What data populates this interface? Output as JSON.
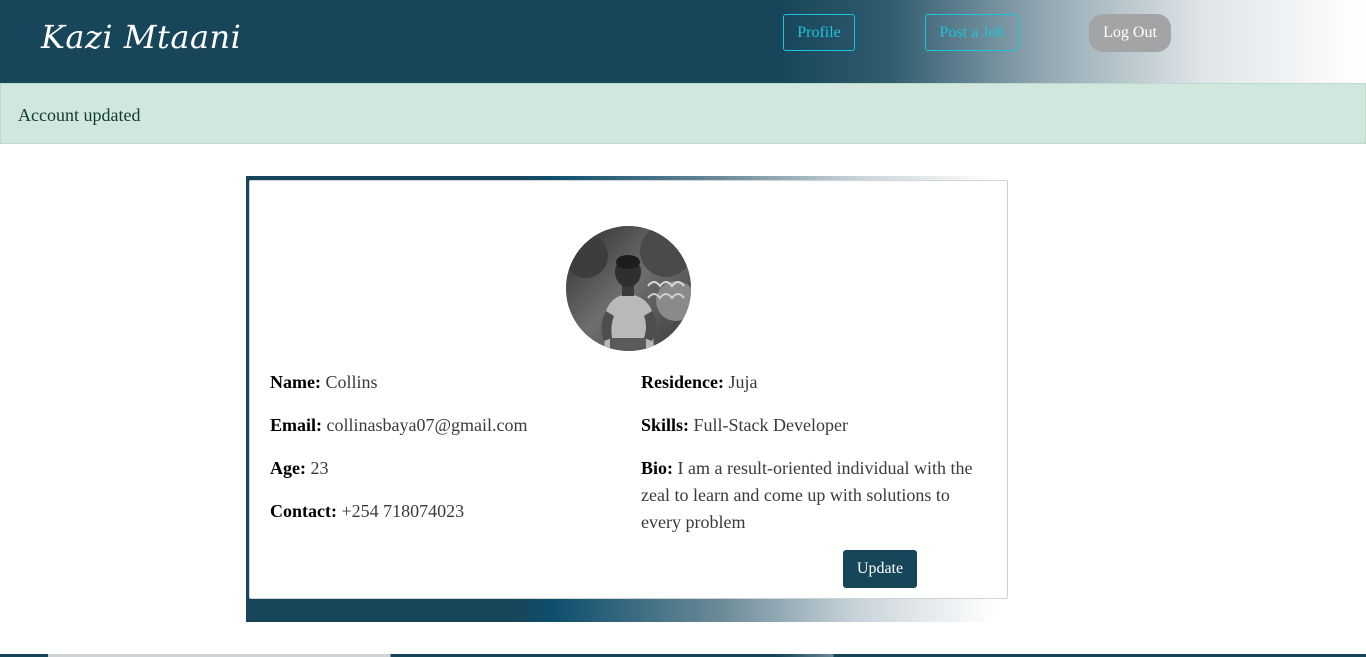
{
  "navbar": {
    "brand": "Kazi Mtaani",
    "profile_label": "Profile",
    "post_job_label": "Post a Job",
    "logout_label": "Log Out"
  },
  "alert": {
    "message": "Account updated"
  },
  "profile": {
    "name_label": "Name:",
    "name_value": "Collins",
    "email_label": "Email:",
    "email_value": "collinasbaya07@gmail.com",
    "age_label": "Age:",
    "age_value": "23",
    "contact_label": "Contact:",
    "contact_value": "+254 718074023",
    "residence_label": "Residence:",
    "residence_value": "Juja",
    "skills_label": "Skills:",
    "skills_value": "Full-Stack Developer",
    "bio_label": "Bio:",
    "bio_value": "I am a result-oriented individual with the zeal to learn and come up with solutions to every problem",
    "update_label": "Update"
  },
  "colors": {
    "navbar": "#17465a",
    "nav_link": "#1ec3dc",
    "logout_bg": "#a3a4a6",
    "alert_bg": "#d1e7dd",
    "button_bg": "#17465a"
  }
}
